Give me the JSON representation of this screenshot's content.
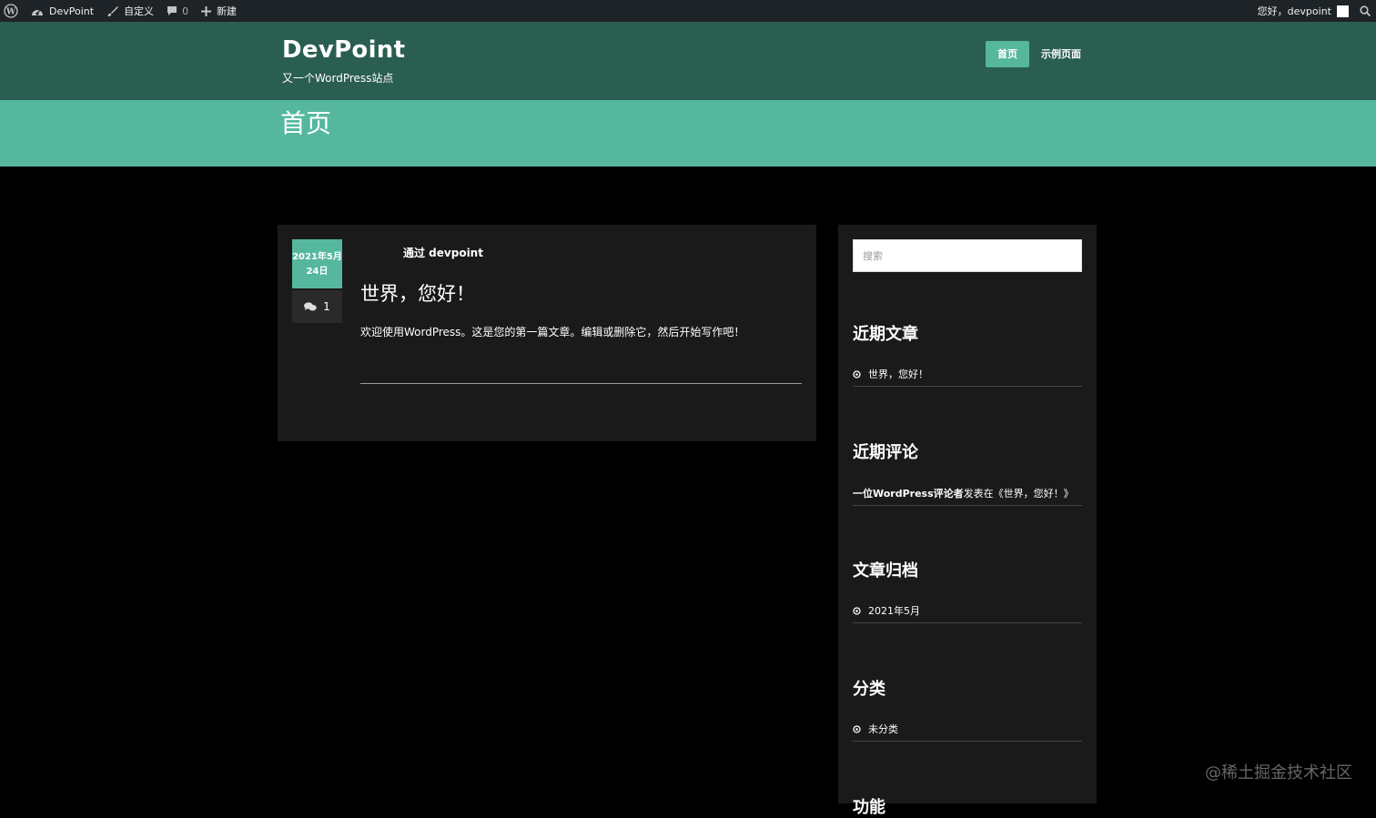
{
  "admin_bar": {
    "site_name": "DevPoint",
    "customize_label": "自定义",
    "comment_count": "0",
    "new_label": "新建",
    "greeting": "您好，devpoint"
  },
  "site": {
    "title": "DevPoint",
    "description": "又一个WordPress站点"
  },
  "nav": {
    "items": [
      {
        "label": "首页",
        "active": true
      },
      {
        "label": "示例页面",
        "active": false
      }
    ]
  },
  "page_title": "首页",
  "post": {
    "date_line1": "2021年5月",
    "date_line2": "24日",
    "comment_count": "1",
    "author": "通过 devpoint",
    "title": "世界，您好！",
    "excerpt": "欢迎使用WordPress。这是您的第一篇文章。编辑或删除它，然后开始写作吧！"
  },
  "sidebar": {
    "search_placeholder": "搜索",
    "recent_posts": {
      "title": "近期文章",
      "items": [
        "世界，您好！"
      ]
    },
    "recent_comments": {
      "title": "近期评论",
      "author": "一位WordPress评论者",
      "text": "发表在《世界，您好！》"
    },
    "archives": {
      "title": "文章归档",
      "items": [
        "2021年5月"
      ]
    },
    "categories": {
      "title": "分类",
      "items": [
        "未分类"
      ]
    },
    "functions": {
      "title": "功能"
    }
  },
  "watermark": "@稀土掘金技术社区",
  "colors": {
    "admin_bar_bg": "#1d2327",
    "header_bg": "#2a5e50",
    "accent": "#55b89e",
    "page_bg": "#000000",
    "card_bg": "#1a1a1a"
  }
}
